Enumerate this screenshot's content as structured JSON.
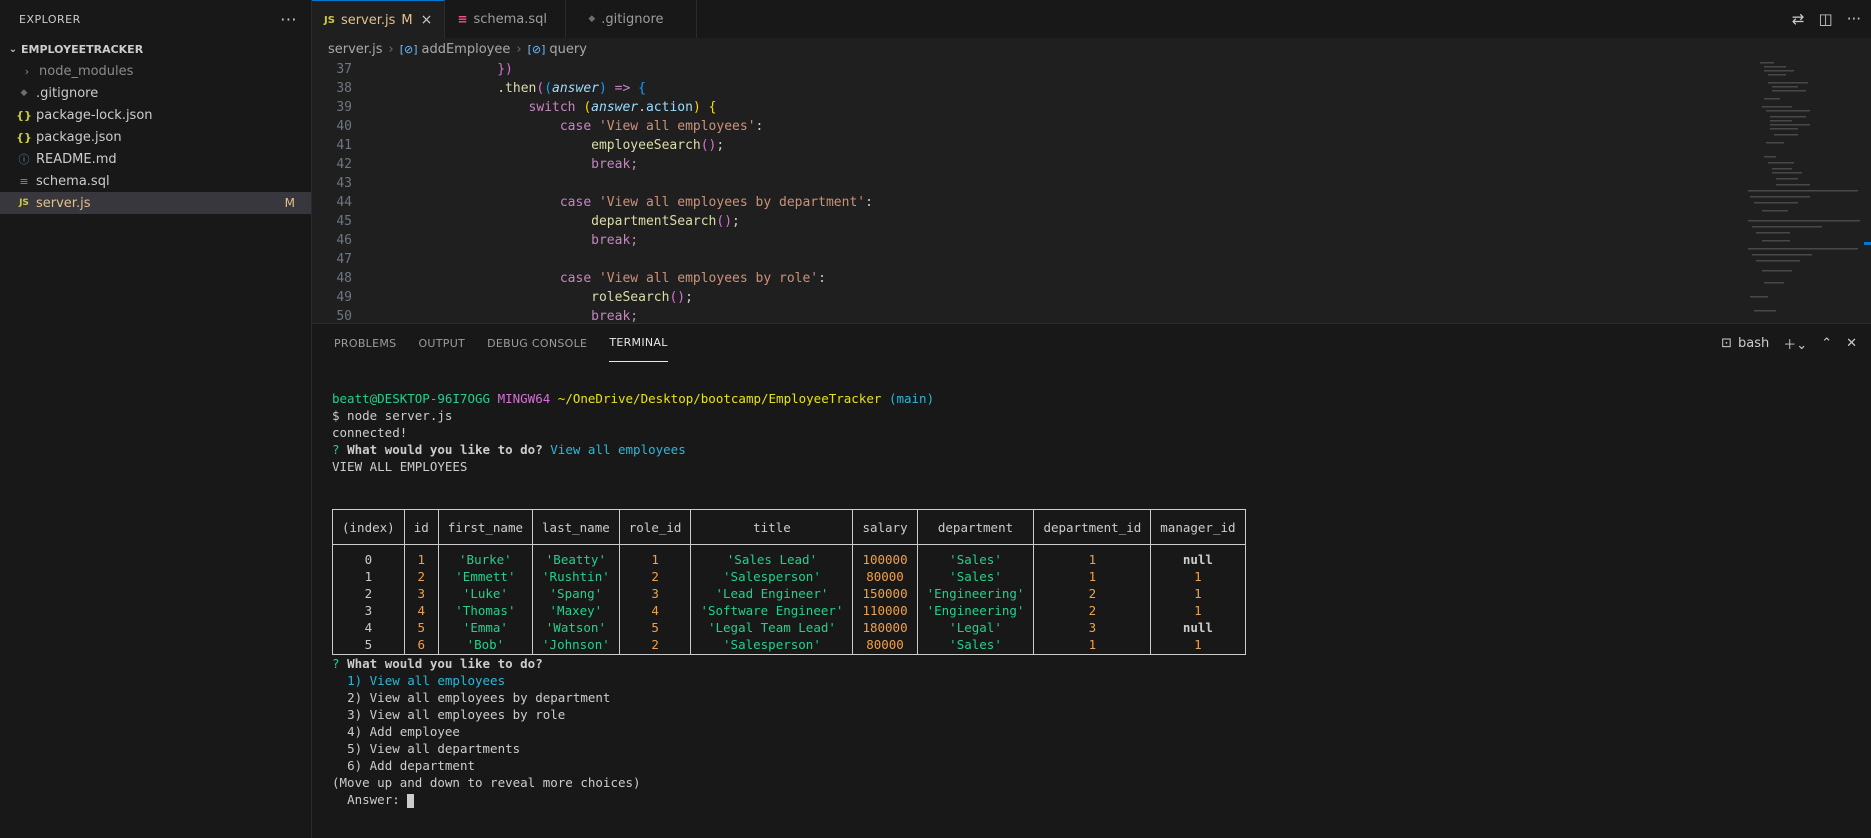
{
  "sidebar": {
    "title": "EXPLORER",
    "more": "···",
    "section": "EMPLOYEETRACKER",
    "items": [
      {
        "label": "node_modules",
        "icon": "›"
      },
      {
        "label": ".gitignore",
        "icon": "◆"
      },
      {
        "label": "package-lock.json",
        "icon": "{}"
      },
      {
        "label": "package.json",
        "icon": "{}"
      },
      {
        "label": "README.md",
        "icon": "ⓘ"
      },
      {
        "label": "schema.sql",
        "icon": "≡"
      },
      {
        "label": "server.js",
        "icon": "JS",
        "badge": "M"
      }
    ]
  },
  "tabs": [
    {
      "label": "server.js",
      "icon": "JS",
      "modified": "M",
      "close": "×"
    },
    {
      "label": "schema.sql",
      "icon": "≡"
    },
    {
      "label": ".gitignore",
      "icon": "◆"
    }
  ],
  "breadcrumb": {
    "file": "server.js",
    "fn": "addEmployee",
    "sym": "query"
  },
  "code_lines": [
    "37",
    "38",
    "39",
    "40",
    "41",
    "42",
    "43",
    "44",
    "45",
    "46",
    "47",
    "48",
    "49",
    "50"
  ],
  "code": {
    "l37": "})",
    "l38_then": ".then",
    "l38_param": "answer",
    "l38_arrow": " => ",
    "l39_switch": "switch",
    "l39_arg": "answer",
    "l39_prop": "action",
    "case": "case",
    "break": "break;",
    "c1": "'View all employees'",
    "f1": "employeeSearch",
    "c2": "'View all employees by department'",
    "f2": "departmentSearch",
    "c3": "'View all employees by role'",
    "f3": "roleSearch"
  },
  "panel": {
    "tabs": [
      "PROBLEMS",
      "OUTPUT",
      "DEBUG CONSOLE",
      "TERMINAL"
    ],
    "shell": "bash"
  },
  "terminal": {
    "user": "beatt@DESKTOP-96I7OGG",
    "env": "MINGW64",
    "path": "~/OneDrive/Desktop/bootcamp/EmployeeTracker",
    "branch": "(main)",
    "cmd": "$ node server.js",
    "connected": "connected!",
    "q_mark": "?",
    "question": "What would you like to do?",
    "answer1": "View all employees",
    "header_line": "VIEW ALL EMPLOYEES",
    "table": {
      "columns": [
        "(index)",
        "id",
        "first_name",
        "last_name",
        "role_id",
        "title",
        "salary",
        "department",
        "department_id",
        "manager_id"
      ],
      "rows": [
        [
          "0",
          "1",
          "'Burke'",
          "'Beatty'",
          "1",
          "'Sales Lead'",
          "100000",
          "'Sales'",
          "1",
          "null"
        ],
        [
          "1",
          "2",
          "'Emmett'",
          "'Rushtin'",
          "2",
          "'Salesperson'",
          "80000",
          "'Sales'",
          "1",
          "1"
        ],
        [
          "2",
          "3",
          "'Luke'",
          "'Spang'",
          "3",
          "'Lead Engineer'",
          "150000",
          "'Engineering'",
          "2",
          "1"
        ],
        [
          "3",
          "4",
          "'Thomas'",
          "'Maxey'",
          "4",
          "'Software Engineer'",
          "110000",
          "'Engineering'",
          "2",
          "1"
        ],
        [
          "4",
          "5",
          "'Emma'",
          "'Watson'",
          "5",
          "'Legal Team Lead'",
          "180000",
          "'Legal'",
          "3",
          "null"
        ],
        [
          "5",
          "6",
          "'Bob'",
          "'Johnson'",
          "2",
          "'Salesperson'",
          "80000",
          "'Sales'",
          "1",
          "1"
        ]
      ]
    },
    "choices": [
      "1) View all employees",
      "2) View all employees by department",
      "3) View all employees by role",
      "4) Add employee",
      "5) View all departments",
      "6) Add department"
    ],
    "hint": "(Move up and down to reveal more choices)",
    "answer_prompt": "Answer:"
  },
  "colors": {
    "accent": "#0078d4",
    "modified": "#e2c08d",
    "string": "#23d18b",
    "number": "#f0a04b"
  }
}
